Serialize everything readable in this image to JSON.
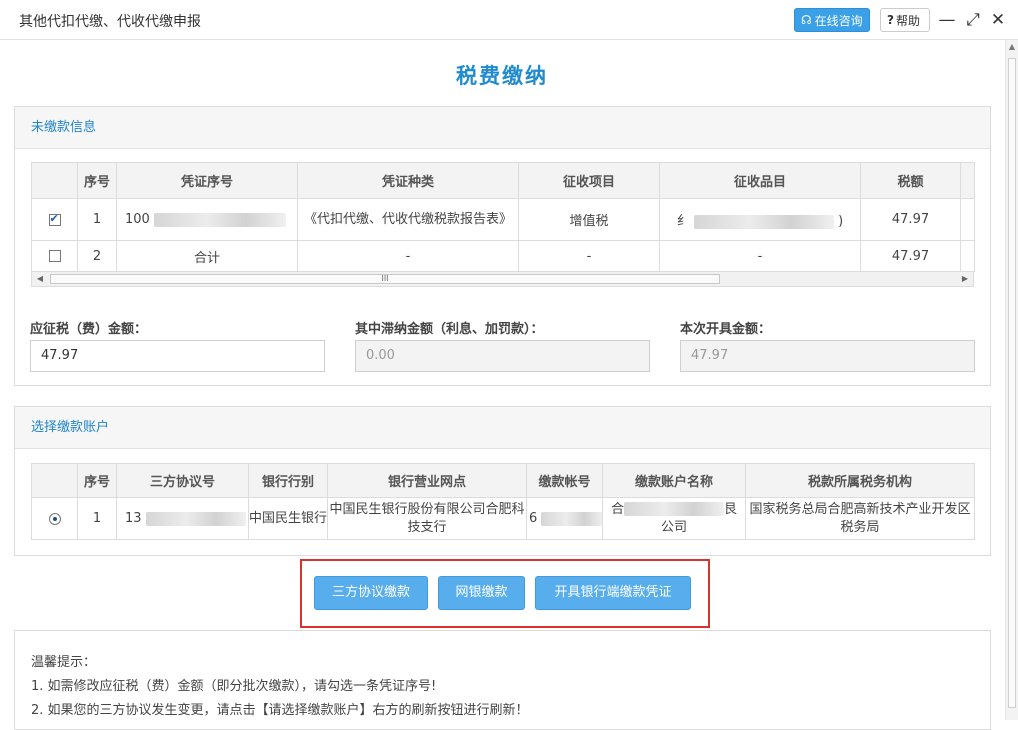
{
  "window": {
    "title": "其他代扣代缴、代收代缴申报",
    "consult_label": "在线咨询",
    "help_label": "帮助",
    "minimize_glyph": "—",
    "maximize_glyph": "⤢",
    "close_glyph": "✕"
  },
  "page_title": "税费缴纳",
  "unpaid": {
    "header": "未缴款信息",
    "columns": [
      "序号",
      "凭证序号",
      "凭证种类",
      "征收项目",
      "征收品目",
      "税额"
    ],
    "rows": [
      {
        "checked": true,
        "index": "1",
        "voucher_no": "100",
        "voucher_type": "《代扣代缴、代收代缴税款报告表》",
        "item": "增值税",
        "sub_item_prefix": "纟",
        "sub_item_suffix": ")",
        "amount": "47.97"
      },
      {
        "checked": false,
        "index": "2",
        "voucher_no": "合计",
        "voucher_type": "-",
        "item": "-",
        "sub_item": "-",
        "amount": "47.97"
      }
    ],
    "scroll_grip": "III"
  },
  "amounts": {
    "payable_label": "应征税（费）金额：",
    "payable_value": "47.97",
    "late_fee_label": "其中滞纳金额（利息、加罚款）：",
    "late_fee_value": "0.00",
    "issued_label": "本次开具金额：",
    "issued_value": "47.97"
  },
  "account": {
    "header": "选择缴款账户",
    "columns": [
      "序号",
      "三方协议号",
      "银行行别",
      "银行营业网点",
      "缴款帐号",
      "缴款账户名称",
      "税款所属税务机构"
    ],
    "rows": [
      {
        "selected": true,
        "index": "1",
        "agreement_no": "13",
        "bank": "中国民生银行",
        "branch": "中国民生银行股份有限公司合肥科技支行",
        "account_no": "6",
        "account_name_prefix": "合",
        "account_name_mid": "艮",
        "account_name_suffix": "公司",
        "tax_org": "国家税务总局合肥高新技术产业开发区税务局"
      }
    ]
  },
  "buttons": {
    "tripartite": "三方协议缴款",
    "online_bank": "网银缴款",
    "bank_voucher": "开具银行端缴款凭证"
  },
  "tips": {
    "title": "温馨提示：",
    "lines": [
      "1. 如需修改应征税（费）金额（即分批次缴款），请勾选一条凭证序号!",
      "2. 如果您的三方协议发生变更，请点击【请选择缴款账户】右方的刷新按钮进行刷新！"
    ]
  },
  "colors": {
    "accent": "#1f8ccf",
    "button": "#58aeec",
    "highlight_border": "#d9342b"
  }
}
